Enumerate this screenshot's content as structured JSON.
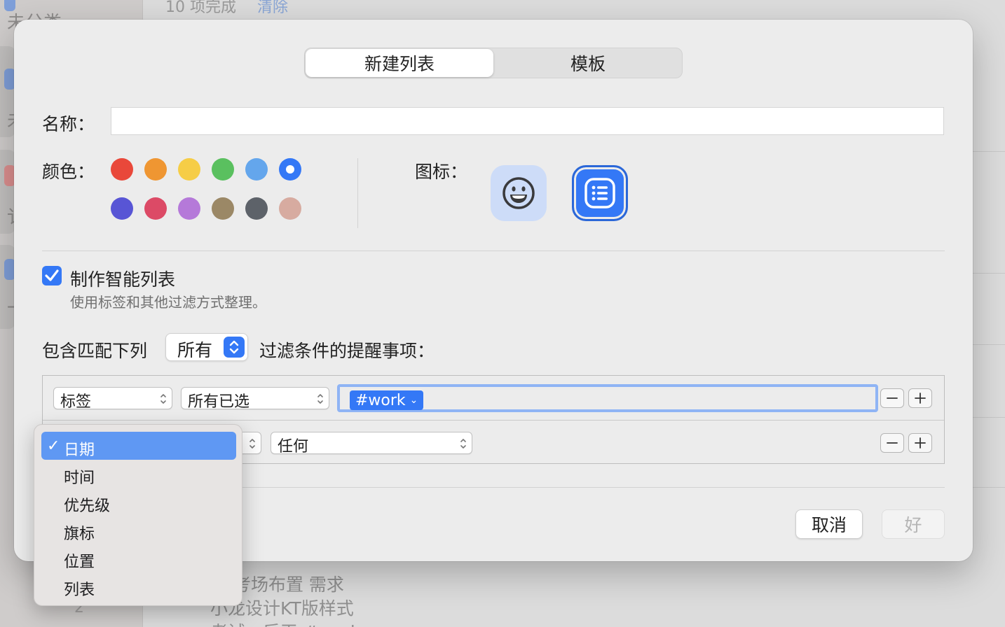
{
  "background": {
    "sidebar_texts": [
      "未分类",
      "未",
      "讠",
      "一"
    ],
    "top_partial": {
      "text": "10 项完成",
      "link": "清除"
    },
    "tasks": [
      "文 考场布置 需求",
      "小龙设计KT版样式",
      "考试 - 后天 #work"
    ],
    "count": "2"
  },
  "dialog": {
    "tabs": [
      {
        "label": "新建列表",
        "active": true
      },
      {
        "label": "模板",
        "active": false
      }
    ],
    "name": {
      "label": "名称：",
      "value": "",
      "placeholder": ""
    },
    "color": {
      "label": "颜色：",
      "swatches": [
        "#e9483a",
        "#ef9632",
        "#f6cd46",
        "#5ac05f",
        "#64a6ec",
        "#3478f6",
        "#5855d5",
        "#dc4a66",
        "#b579d9",
        "#9b8866",
        "#5d6269",
        "#d7aba0"
      ],
      "selected_index": 5
    },
    "icon": {
      "label": "图标：",
      "options": [
        "smiley-face-icon",
        "list-bullet-icon"
      ],
      "selected": "list-bullet-icon"
    },
    "smart_list": {
      "checked": true,
      "title": "制作智能列表",
      "subtitle": "使用标签和其他过滤方式整理。"
    },
    "match": {
      "prefix": "包含匹配下列",
      "value": "所有",
      "suffix": "过滤条件的提醒事项："
    },
    "filters": [
      {
        "field": "标签",
        "operator": "所有已选",
        "tokens": [
          "#work"
        ]
      },
      {
        "field": "日期",
        "operator": "任何"
      }
    ],
    "buttons": {
      "cancel": "取消",
      "ok": "好",
      "ok_enabled": false
    }
  },
  "menu": {
    "items": [
      "日期",
      "时间",
      "优先级",
      "旗标",
      "位置",
      "列表"
    ],
    "checked_index": 0,
    "highlighted_index": 0,
    "check_mark": "✓"
  },
  "colors": {
    "accent": "#3478f6",
    "menu_highlight": "#5f98f3"
  }
}
